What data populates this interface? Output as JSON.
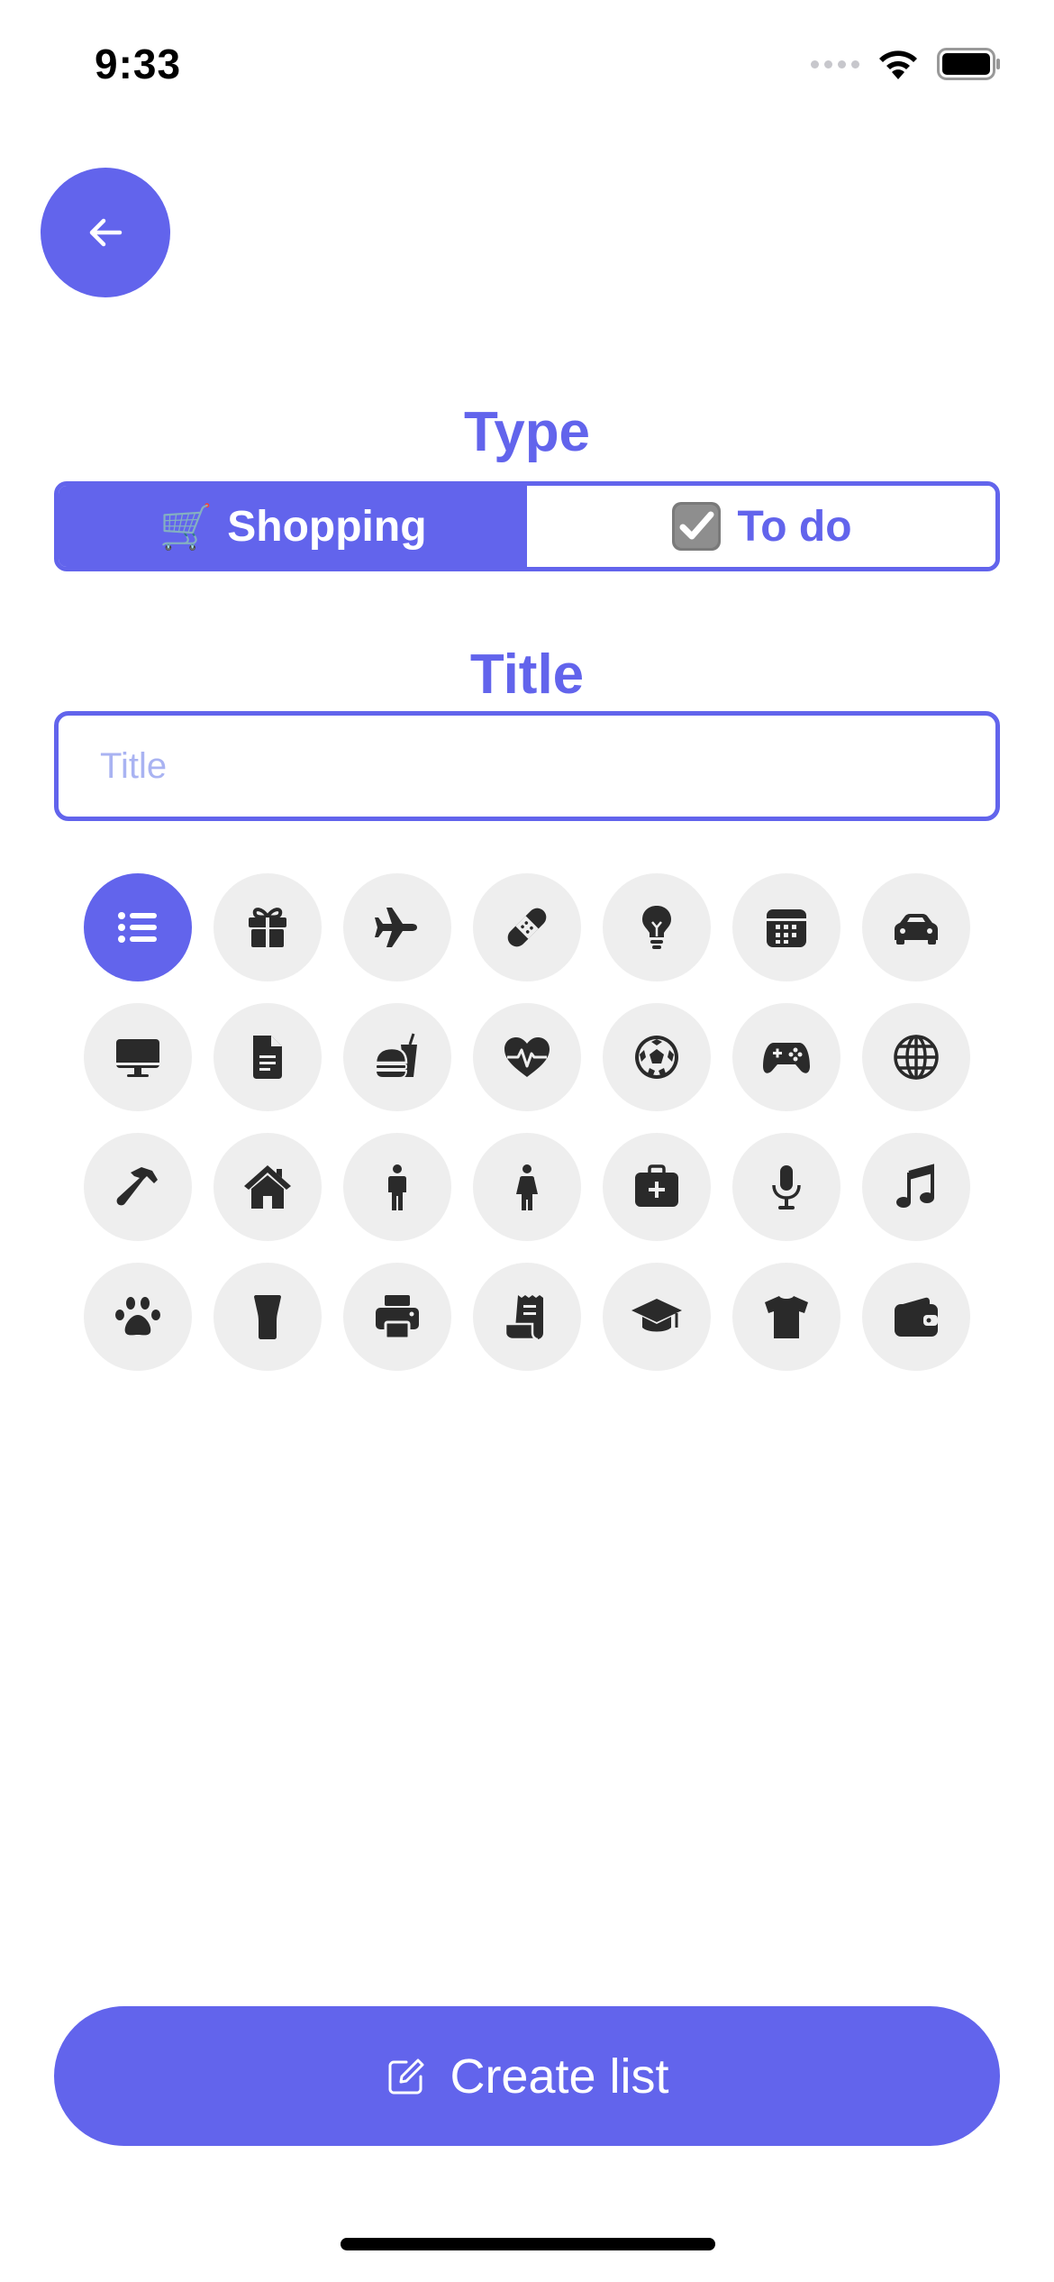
{
  "status_bar": {
    "time": "9:33"
  },
  "back": {
    "icon": "arrow-left-icon"
  },
  "type_section": {
    "heading": "Type",
    "options": [
      {
        "emoji": "🛒",
        "label": "Shopping",
        "selected": true
      },
      {
        "emoji": "☑️",
        "label": "To do",
        "selected": false
      }
    ]
  },
  "title_section": {
    "heading": "Title",
    "input": {
      "value": "",
      "placeholder": "Title"
    }
  },
  "icons": {
    "selected_index": 0,
    "items": [
      "list-icon",
      "gift-icon",
      "airplane-icon",
      "bandage-icon",
      "lightbulb-icon",
      "calendar-icon",
      "car-icon",
      "desktop-icon",
      "document-icon",
      "food-icon",
      "heart-pulse-icon",
      "soccer-ball-icon",
      "gamepad-icon",
      "globe-icon",
      "hammer-icon",
      "house-icon",
      "man-icon",
      "woman-icon",
      "medical-kit-icon",
      "microphone-icon",
      "music-note-icon",
      "paw-icon",
      "glass-icon",
      "printer-icon",
      "receipt-icon",
      "graduation-cap-icon",
      "tshirt-icon",
      "wallet-icon"
    ]
  },
  "create_button": {
    "label": "Create list",
    "icon": "compose-icon"
  },
  "colors": {
    "accent": "#6264ec",
    "icon_bg": "#eeeeee",
    "icon_fg": "#2a2a2a",
    "placeholder": "#a9b3f2"
  }
}
